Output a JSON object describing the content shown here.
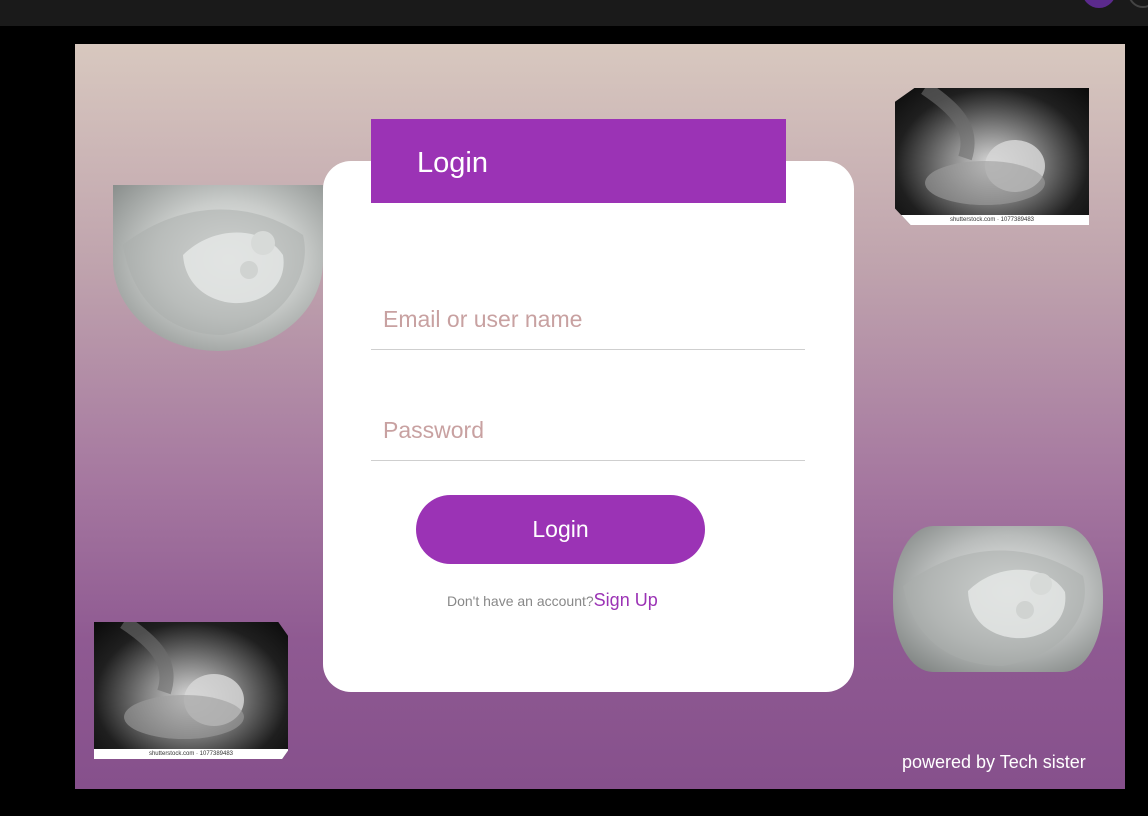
{
  "login_header": {
    "title": "Login"
  },
  "form": {
    "email_placeholder": "Email or user name",
    "email_value": "",
    "password_placeholder": "Password",
    "password_value": "",
    "login_button_label": "Login"
  },
  "signup": {
    "prompt": "Don't  have an account?",
    "link_label": "Sign Up"
  },
  "footer": {
    "powered_by": "powered by Tech sister"
  },
  "photos": {
    "credit_text": "shutterstock.com · 1077389483"
  },
  "colors": {
    "accent": "#9b33b5",
    "card": "#ffffff",
    "background_top": "#d8c8bf",
    "background_bottom": "#86508c"
  }
}
